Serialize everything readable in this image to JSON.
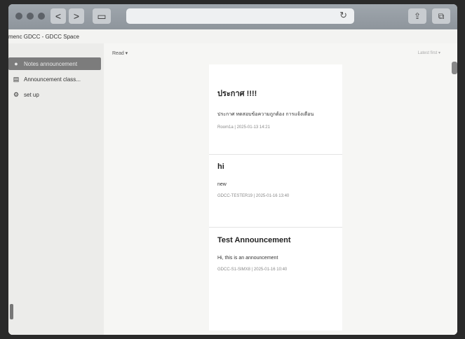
{
  "browser": {
    "back": "<",
    "forward": ">",
    "reload": "↻"
  },
  "breadcrumb": "menc  GDCC - GDCC Space",
  "sidebar": {
    "items": [
      {
        "label": "Notes announcement",
        "icon": "dot-icon",
        "active": true
      },
      {
        "label": "Announcement class...",
        "icon": "list-icon",
        "active": false
      },
      {
        "label": "set up",
        "icon": "gear-icon",
        "active": false
      }
    ]
  },
  "main": {
    "filter_label": "Read ▾",
    "top_right": "Latest first ▾"
  },
  "posts": [
    {
      "title": "ประกาศ !!!!",
      "body": "ประกาศ ทดสอบข้อความถูกต้อง การแจ้งเตือน",
      "meta": "Room1a | 2025-01-13 14:21"
    },
    {
      "title": "hi",
      "body": "new",
      "meta": "GDCC-TESTER19 | 2025-01-16 13:40"
    },
    {
      "title": "Test Announcement",
      "body": "Hi, this is an announcement",
      "meta": "GDCC-S1-SIMX8 | 2025-01-16 10:40"
    }
  ]
}
